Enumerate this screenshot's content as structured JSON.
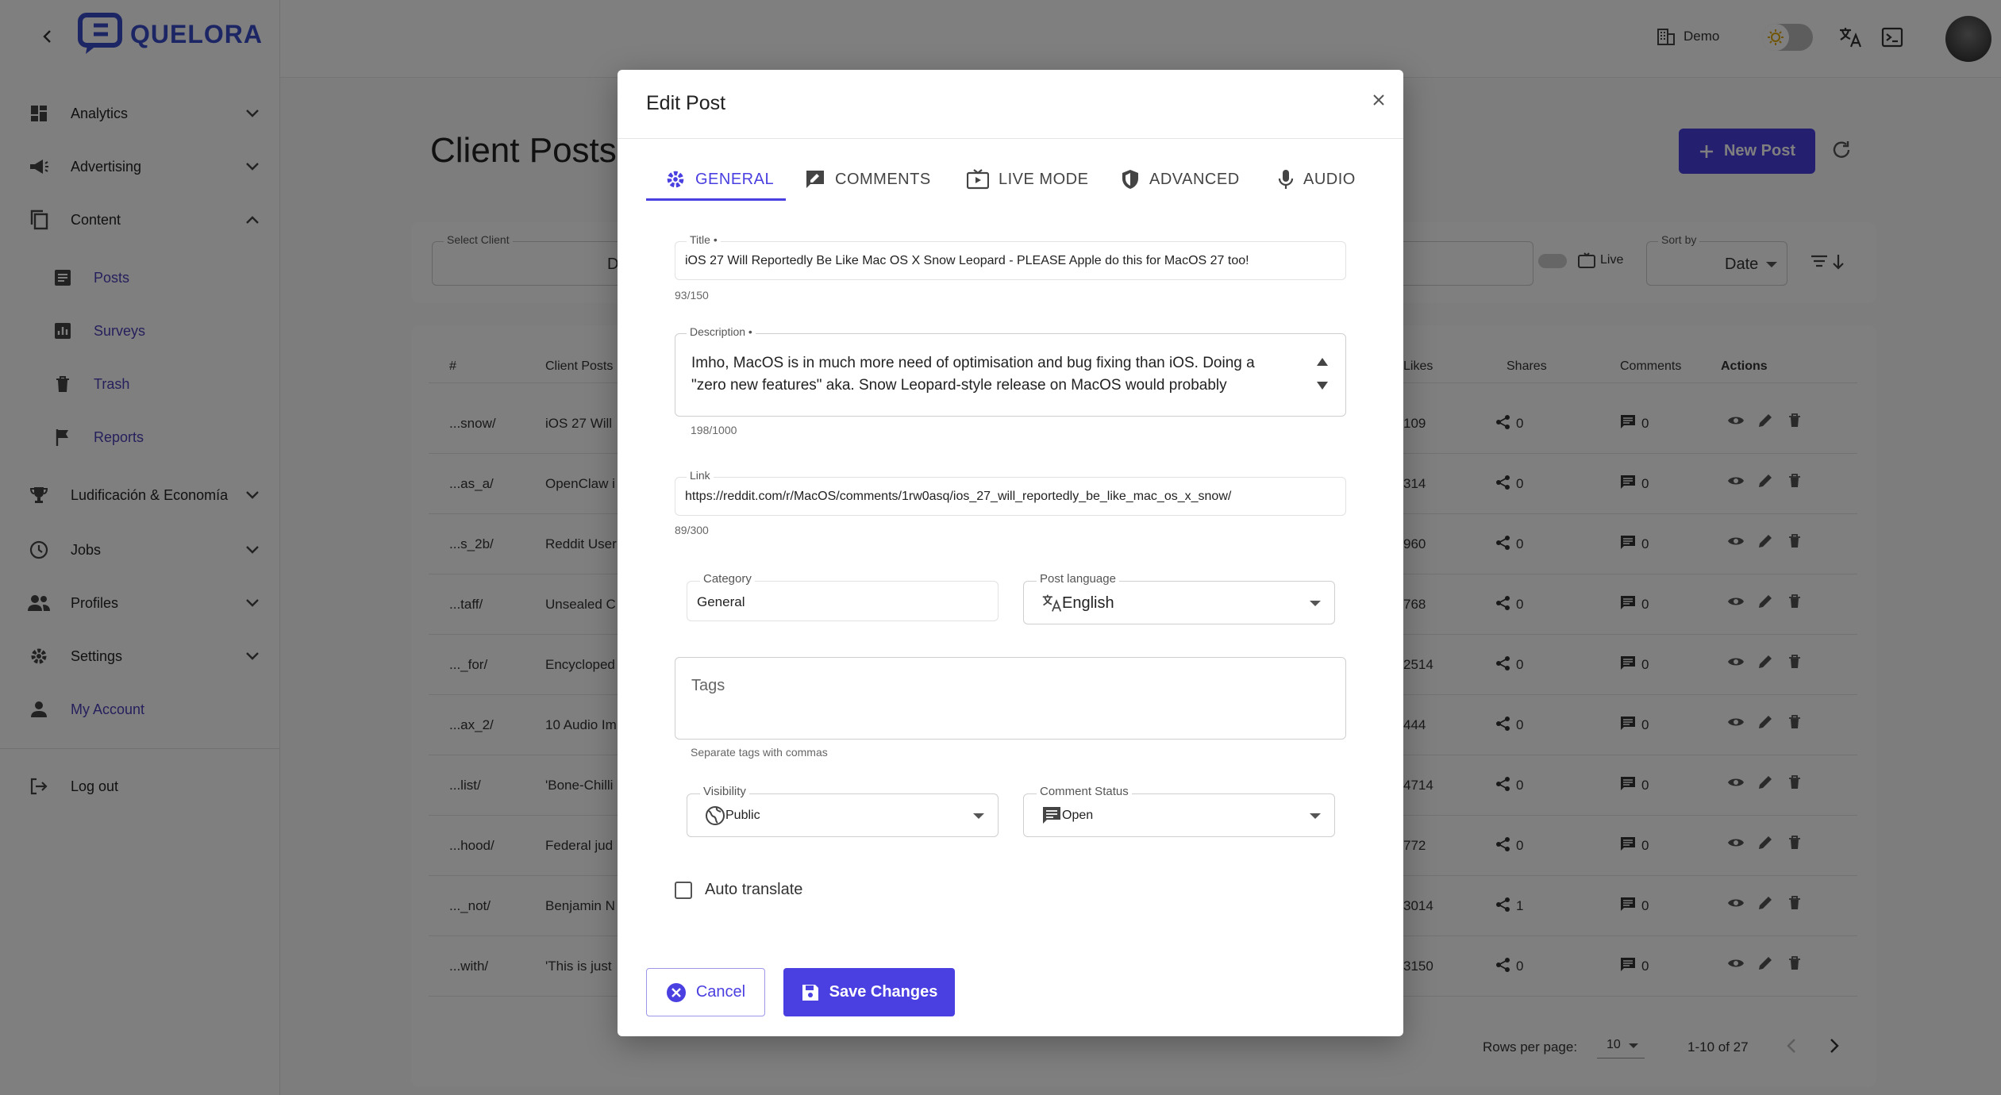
{
  "brand": {
    "name": "QUELORA",
    "color": "#3b4cca",
    "accent": "#4a3fe0"
  },
  "sidebar": {
    "items": [
      {
        "label": "Analytics",
        "icon": "dashboard-icon"
      },
      {
        "label": "Advertising",
        "icon": "megaphone-icon"
      },
      {
        "label": "Content",
        "icon": "copy-icon"
      },
      {
        "label": "Posts",
        "icon": "article-icon"
      },
      {
        "label": "Surveys",
        "icon": "bar-chart-icon"
      },
      {
        "label": "Trash",
        "icon": "trash-icon"
      },
      {
        "label": "Reports",
        "icon": "flag-icon"
      },
      {
        "label": "Ludificación & Economía",
        "icon": "trophy-icon"
      },
      {
        "label": "Jobs",
        "icon": "clock-icon"
      },
      {
        "label": "Profiles",
        "icon": "people-icon"
      },
      {
        "label": "Settings",
        "icon": "gear-icon"
      },
      {
        "label": "My Account",
        "icon": "person-icon"
      }
    ],
    "logout": "Log out"
  },
  "topbar": {
    "workspace": "Demo"
  },
  "page": {
    "title": "Client Posts",
    "new_post": "New Post",
    "select_client_label": "Select Client",
    "select_client_value": "Dem",
    "live_label": "Live",
    "sort_label": "Sort by",
    "sort_value": "Date"
  },
  "table": {
    "headers": [
      "#",
      "Client Posts",
      "Likes",
      "Shares",
      "Comments",
      "Actions"
    ],
    "rows": [
      {
        "id": "...snow/",
        "title": "iOS 27 Will",
        "likes": "109",
        "shares": "0",
        "comments": "0"
      },
      {
        "id": "...as_a/",
        "title": "OpenClaw i",
        "likes": "314",
        "shares": "0",
        "comments": "0"
      },
      {
        "id": "...s_2b/",
        "title": "Reddit User",
        "likes": "960",
        "shares": "0",
        "comments": "0"
      },
      {
        "id": "...taff/",
        "title": "Unsealed C",
        "likes": "768",
        "shares": "0",
        "comments": "0"
      },
      {
        "id": "..._for/",
        "title": "Encycloped",
        "likes": "2514",
        "shares": "0",
        "comments": "0"
      },
      {
        "id": "...ax_2/",
        "title": "10 Audio Im",
        "likes": "444",
        "shares": "0",
        "comments": "0"
      },
      {
        "id": "...list/",
        "title": "'Bone-Chilli",
        "likes": "4714",
        "shares": "0",
        "comments": "0"
      },
      {
        "id": "...hood/",
        "title": "Federal jud",
        "likes": "772",
        "shares": "0",
        "comments": "0"
      },
      {
        "id": "..._not/",
        "title": "Benjamin N",
        "likes": "3014",
        "shares": "1",
        "comments": "0"
      },
      {
        "id": "...with/",
        "title": "'This is just",
        "likes": "3150",
        "shares": "0",
        "comments": "0"
      }
    ],
    "rows_per_page_label": "Rows per page:",
    "rows_per_page": "10",
    "range": "1-10 of 27"
  },
  "modal": {
    "title": "Edit Post",
    "tabs": [
      "GENERAL",
      "COMMENTS",
      "LIVE MODE",
      "ADVANCED",
      "AUDIO"
    ],
    "title_label": "Title",
    "title_value": "iOS 27 Will Reportedly Be Like Mac OS X Snow Leopard - PLEASE Apple do this for MacOS 27 too!",
    "title_counter": "93/150",
    "description_label": "Description",
    "description_line1": "Imho, MacOS is in much more need of optimisation and bug fixing than iOS. Doing a",
    "description_line2": "\"zero new features\"  aka. Snow Leopard-style release on MacOS would probably",
    "description_counter": "198/1000",
    "link_label": "Link",
    "link_value": "https://reddit.com/r/MacOS/comments/1rw0asq/ios_27_will_reportedly_be_like_mac_os_x_snow/",
    "link_counter": "89/300",
    "category_label": "Category",
    "category_value": "General",
    "language_label": "Post language",
    "language_value": "English",
    "tags_placeholder": "Tags",
    "tags_helper": "Separate tags with commas",
    "visibility_label": "Visibility",
    "visibility_value": "Public",
    "comment_status_label": "Comment Status",
    "comment_status_value": "Open",
    "auto_translate": "Auto translate",
    "cancel": "Cancel",
    "save": "Save Changes"
  }
}
